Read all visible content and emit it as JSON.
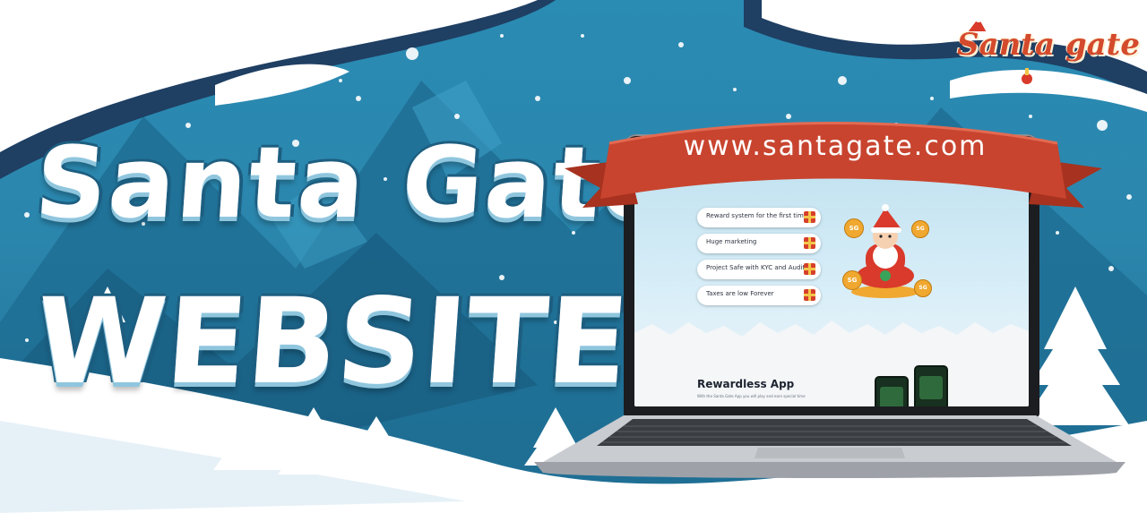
{
  "banner": {
    "headline_line1": "Santa Gate",
    "headline_line2": "WEBSITE",
    "logo_text": "Santa gate",
    "url": "www.santagate.com"
  },
  "screen": {
    "features": [
      {
        "label": "Reward system for the first time",
        "icon": "gift-icon"
      },
      {
        "label": "Huge marketing",
        "icon": "gift-icon"
      },
      {
        "label": "Project Safe with KYC and Audit",
        "icon": "gift-icon"
      },
      {
        "label": "Taxes are low Forever",
        "icon": "gift-icon"
      }
    ],
    "coin_label": "SG",
    "app_title": "Rewardless App",
    "app_subtitle": "With the Santa Gate App you will play and earn special time"
  },
  "colors": {
    "sky": "#2a8bb3",
    "mountain": "#1d6b90",
    "snow": "#ffffff",
    "ribbon": "#c8442f",
    "coin": "#f0a830",
    "santa_red": "#d93a2b"
  }
}
